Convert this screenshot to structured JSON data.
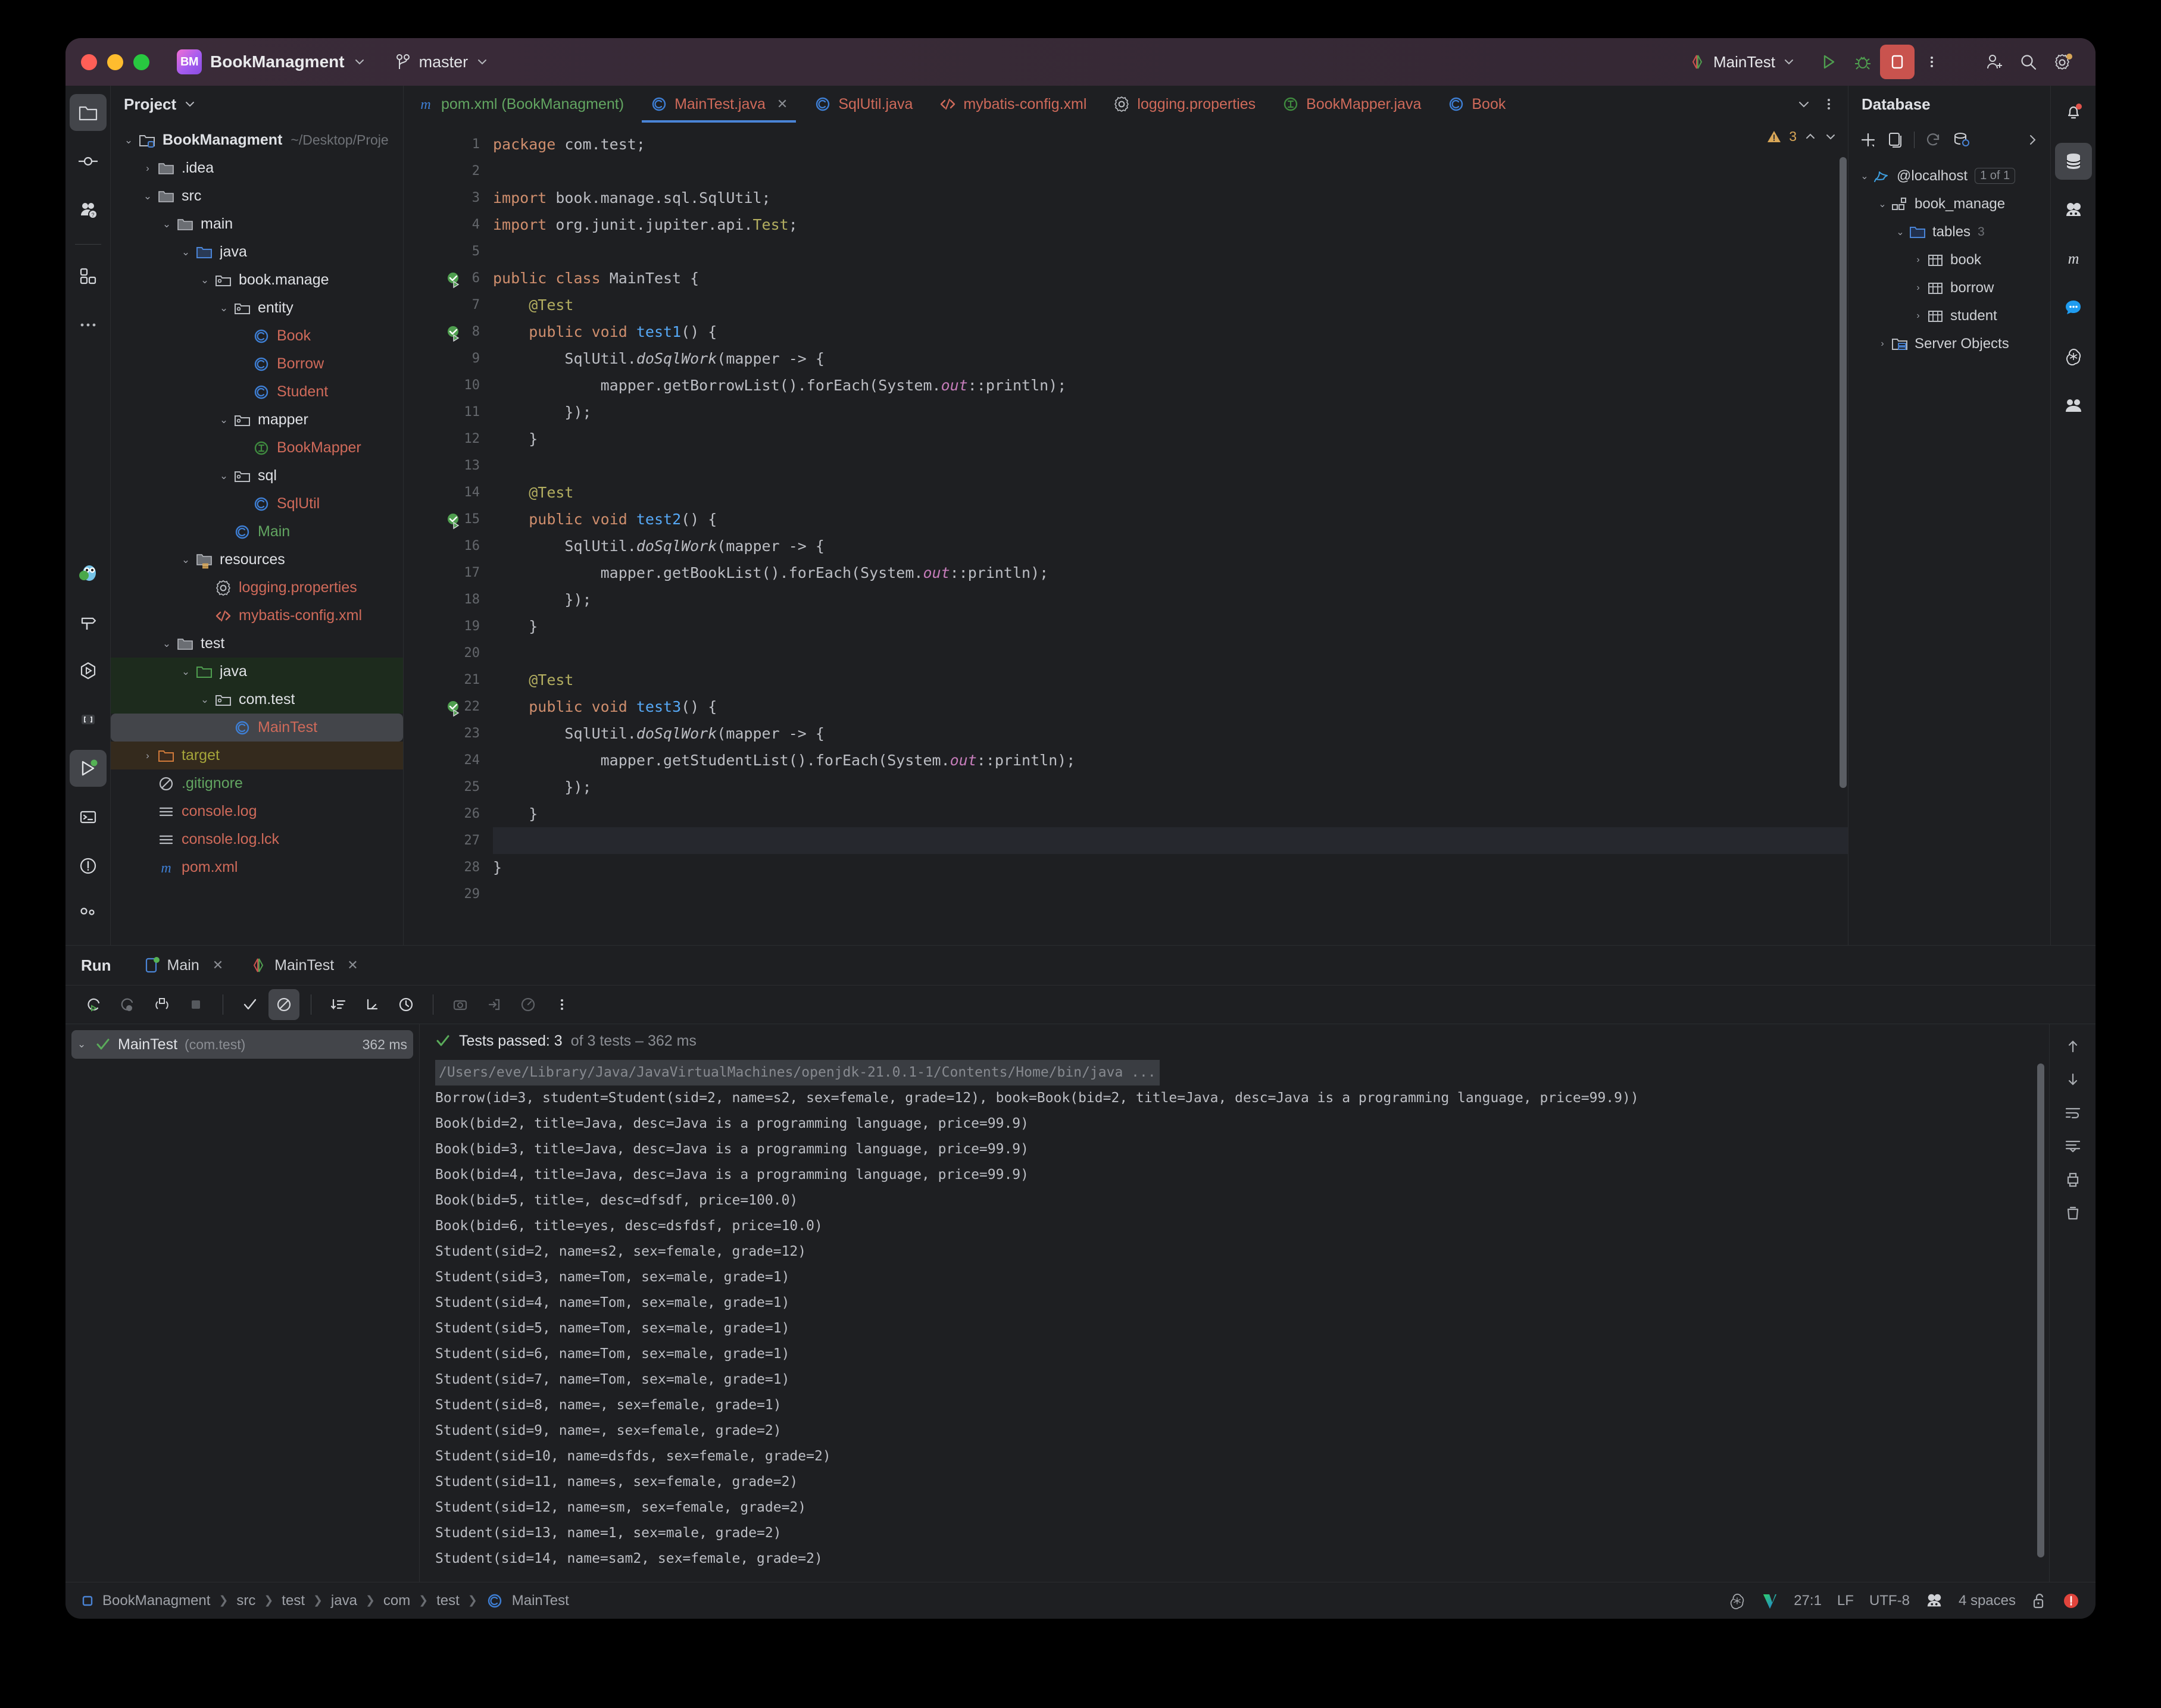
{
  "window": {
    "project_badge": "BM",
    "project_name": "BookManagment",
    "branch": "master"
  },
  "toolbar": {
    "run_config": "MainTest",
    "run_icon": "run-icon",
    "debug_icon": "debug-icon",
    "stop_icon": "stop-icon",
    "more_icon": "more-vertical-icon",
    "add_user_icon": "add-user-icon",
    "search_icon": "search-icon",
    "settings_icon": "settings-gear-icon"
  },
  "left_rail": {
    "top_items": [
      "project-icon",
      "commit-icon",
      "ai-assistant-icon",
      "structure-icon",
      "more-icon"
    ],
    "bottom_items": [
      "owl-icon",
      "build-hammer-icon",
      "services-icon",
      "bookmarks-icon",
      "run-icon",
      "terminal-icon",
      "problems-icon",
      "version-control-icon"
    ]
  },
  "project_panel": {
    "title": "Project",
    "tree": [
      {
        "depth": 0,
        "arrow": "down",
        "icon": "module-folder-icon",
        "label": "BookManagment",
        "sub": "~/Desktop/Proje",
        "cls": "c-white bold"
      },
      {
        "depth": 1,
        "arrow": "right",
        "icon": "folder-icon",
        "label": ".idea",
        "cls": "c-white"
      },
      {
        "depth": 1,
        "arrow": "down",
        "icon": "folder-icon",
        "label": "src",
        "cls": "c-white"
      },
      {
        "depth": 2,
        "arrow": "down",
        "icon": "folder-icon",
        "label": "main",
        "cls": "c-white"
      },
      {
        "depth": 3,
        "arrow": "down",
        "icon": "source-folder-icon",
        "label": "java",
        "cls": "c-white"
      },
      {
        "depth": 4,
        "arrow": "down",
        "icon": "package-icon",
        "label": "book.manage",
        "cls": "c-white"
      },
      {
        "depth": 5,
        "arrow": "down",
        "icon": "package-icon",
        "label": "entity",
        "cls": "c-white"
      },
      {
        "depth": 6,
        "arrow": "",
        "icon": "java-class-icon",
        "label": "Book",
        "cls": "c-red"
      },
      {
        "depth": 6,
        "arrow": "",
        "icon": "java-class-icon",
        "label": "Borrow",
        "cls": "c-red"
      },
      {
        "depth": 6,
        "arrow": "",
        "icon": "java-class-icon",
        "label": "Student",
        "cls": "c-red"
      },
      {
        "depth": 5,
        "arrow": "down",
        "icon": "package-icon",
        "label": "mapper",
        "cls": "c-white"
      },
      {
        "depth": 6,
        "arrow": "",
        "icon": "java-interface-icon",
        "label": "BookMapper",
        "cls": "c-red"
      },
      {
        "depth": 5,
        "arrow": "down",
        "icon": "package-icon",
        "label": "sql",
        "cls": "c-white"
      },
      {
        "depth": 6,
        "arrow": "",
        "icon": "java-class-icon",
        "label": "SqlUtil",
        "cls": "c-red"
      },
      {
        "depth": 5,
        "arrow": "",
        "icon": "java-class-icon",
        "label": "Main",
        "cls": "c-green"
      },
      {
        "depth": 3,
        "arrow": "down",
        "icon": "resource-folder-icon",
        "label": "resources",
        "cls": "c-white"
      },
      {
        "depth": 4,
        "arrow": "",
        "icon": "properties-icon",
        "label": "logging.properties",
        "cls": "c-red"
      },
      {
        "depth": 4,
        "arrow": "",
        "icon": "xml-icon",
        "label": "mybatis-config.xml",
        "cls": "c-red"
      },
      {
        "depth": 2,
        "arrow": "down",
        "icon": "folder-icon",
        "label": "test",
        "cls": "c-white"
      },
      {
        "depth": 3,
        "arrow": "down",
        "icon": "test-source-folder-icon",
        "label": "java",
        "cls": "c-white",
        "bg": "green-bg"
      },
      {
        "depth": 4,
        "arrow": "down",
        "icon": "package-icon",
        "label": "com.test",
        "cls": "c-white",
        "bg": "green-bg"
      },
      {
        "depth": 5,
        "arrow": "",
        "icon": "java-class-icon",
        "label": "MainTest",
        "cls": "c-red",
        "bg": "sel"
      },
      {
        "depth": 1,
        "arrow": "right",
        "icon": "excluded-folder-icon",
        "label": "target",
        "cls": "c-olive",
        "bg": "brown-bg"
      },
      {
        "depth": 1,
        "arrow": "",
        "icon": "gitignore-icon",
        "label": ".gitignore",
        "cls": "c-green"
      },
      {
        "depth": 1,
        "arrow": "",
        "icon": "text-file-icon",
        "label": "console.log",
        "cls": "c-red"
      },
      {
        "depth": 1,
        "arrow": "",
        "icon": "text-file-icon",
        "label": "console.log.lck",
        "cls": "c-red"
      },
      {
        "depth": 1,
        "arrow": "",
        "icon": "maven-icon",
        "label": "pom.xml",
        "cls": "c-red"
      }
    ]
  },
  "editor": {
    "tabs": [
      {
        "label": "pom.xml (BookManagment)",
        "icon": "maven-icon",
        "color": "#62a561",
        "active": false,
        "closable": false
      },
      {
        "label": "MainTest.java",
        "icon": "java-class-icon",
        "color": "#cf6a5a",
        "active": true,
        "closable": true
      },
      {
        "label": "SqlUtil.java",
        "icon": "java-class-icon",
        "color": "#cf6a5a",
        "active": false,
        "closable": false
      },
      {
        "label": "mybatis-config.xml",
        "icon": "xml-icon",
        "color": "#cf6a5a",
        "active": false,
        "closable": false
      },
      {
        "label": "logging.properties",
        "icon": "properties-icon",
        "color": "#cf6a5a",
        "active": false,
        "closable": false
      },
      {
        "label": "BookMapper.java",
        "icon": "java-interface-icon",
        "color": "#cf6a5a",
        "active": false,
        "closable": false
      },
      {
        "label": "Book",
        "icon": "java-class-icon",
        "color": "#cf6a5a",
        "active": false,
        "closable": false
      }
    ],
    "tab_overflow_icon": "chevron-down-icon",
    "tab_more_icon": "more-vertical-icon",
    "warning_count": "3",
    "warning_icon": "warning-triangle-icon",
    "lines": [
      {
        "n": 1,
        "mark": "",
        "text": "package com.test;"
      },
      {
        "n": 2,
        "mark": "",
        "text": ""
      },
      {
        "n": 3,
        "mark": "",
        "text": "import book.manage.sql.SqlUtil;"
      },
      {
        "n": 4,
        "mark": "",
        "text": "import org.junit.jupiter.api.Test;"
      },
      {
        "n": 5,
        "mark": "",
        "text": ""
      },
      {
        "n": 6,
        "mark": "test-passed-run-icon",
        "text": "public class MainTest {"
      },
      {
        "n": 7,
        "mark": "",
        "text": "    @Test"
      },
      {
        "n": 8,
        "mark": "test-passed-run-icon",
        "text": "    public void test1() {"
      },
      {
        "n": 9,
        "mark": "",
        "text": "        SqlUtil.doSqlWork(mapper -> {"
      },
      {
        "n": 10,
        "mark": "",
        "text": "            mapper.getBorrowList().forEach(System.out::println);"
      },
      {
        "n": 11,
        "mark": "",
        "text": "        });"
      },
      {
        "n": 12,
        "mark": "",
        "text": "    }"
      },
      {
        "n": 13,
        "mark": "",
        "text": ""
      },
      {
        "n": 14,
        "mark": "",
        "text": "    @Test"
      },
      {
        "n": 15,
        "mark": "test-passed-run-icon",
        "text": "    public void test2() {"
      },
      {
        "n": 16,
        "mark": "",
        "text": "        SqlUtil.doSqlWork(mapper -> {"
      },
      {
        "n": 17,
        "mark": "",
        "text": "            mapper.getBookList().forEach(System.out::println);"
      },
      {
        "n": 18,
        "mark": "",
        "text": "        });"
      },
      {
        "n": 19,
        "mark": "",
        "text": "    }"
      },
      {
        "n": 20,
        "mark": "",
        "text": ""
      },
      {
        "n": 21,
        "mark": "",
        "text": "    @Test"
      },
      {
        "n": 22,
        "mark": "test-passed-run-icon",
        "text": "    public void test3() {"
      },
      {
        "n": 23,
        "mark": "",
        "text": "        SqlUtil.doSqlWork(mapper -> {"
      },
      {
        "n": 24,
        "mark": "",
        "text": "            mapper.getStudentList().forEach(System.out::println);"
      },
      {
        "n": 25,
        "mark": "",
        "text": "        });"
      },
      {
        "n": 26,
        "mark": "",
        "text": "    }"
      },
      {
        "n": 27,
        "mark": "",
        "text": ""
      },
      {
        "n": 28,
        "mark": "",
        "text": "}"
      },
      {
        "n": 29,
        "mark": "",
        "text": ""
      }
    ]
  },
  "database_panel": {
    "title": "Database",
    "toolbar_icons": [
      "add-icon",
      "duplicate-icon",
      "refresh-icon",
      "db-settings-icon",
      "expand-arrow-icon"
    ],
    "tree": [
      {
        "depth": 0,
        "arrow": "down",
        "icon": "mysql-dolphin-icon",
        "label": "@localhost",
        "badge": "1 of 1"
      },
      {
        "depth": 1,
        "arrow": "down",
        "icon": "schema-icon",
        "label": "book_manage"
      },
      {
        "depth": 2,
        "arrow": "down",
        "icon": "tables-folder-icon",
        "label": "tables",
        "count": "3"
      },
      {
        "depth": 3,
        "arrow": "right",
        "icon": "table-icon",
        "label": "book"
      },
      {
        "depth": 3,
        "arrow": "right",
        "icon": "table-icon",
        "label": "borrow"
      },
      {
        "depth": 3,
        "arrow": "right",
        "icon": "table-icon",
        "label": "student"
      },
      {
        "depth": 1,
        "arrow": "right",
        "icon": "server-objects-icon",
        "label": "Server Objects"
      }
    ]
  },
  "right_rail": {
    "items": [
      "notifications-bell-icon",
      "database-icon",
      "ai-assistant-icon",
      "maven-icon",
      "chat-icon",
      "openai-icon",
      "plugins-icon"
    ]
  },
  "run_panel": {
    "label": "Run",
    "tabs": [
      {
        "label": "Main",
        "icon": "run-config-icon"
      },
      {
        "label": "MainTest",
        "icon": "test-config-icon"
      }
    ],
    "toolbar_icons": [
      "rerun-icon",
      "rerun-failed-icon",
      "rerun-auto-icon",
      "stop-icon",
      "show-passed-icon",
      "show-ignored-icon",
      "sort-icon",
      "expand-icon",
      "history-icon",
      "export-icon",
      "import-icon",
      "profile-icon",
      "more-vertical-icon"
    ],
    "tree": {
      "name": "MainTest",
      "package": "(com.test)",
      "duration": "362 ms",
      "status_icon": "check-icon"
    },
    "summary": {
      "passed_label": "Tests passed: 3",
      "detail": "of 3 tests – 362 ms",
      "icon": "check-icon"
    },
    "console_lines": [
      {
        "t": "/Users/eve/Library/Java/JavaVirtualMachines/openjdk-21.0.1-1/Contents/Home/bin/java ...",
        "cmd": true
      },
      {
        "t": "Borrow(id=3, student=Student(sid=2, name=s2, sex=female, grade=12), book=Book(bid=2, title=Java, desc=Java is a programming language, price=99.9))"
      },
      {
        "t": "Book(bid=2, title=Java, desc=Java is a programming language, price=99.9)"
      },
      {
        "t": "Book(bid=3, title=Java, desc=Java is a programming language, price=99.9)"
      },
      {
        "t": "Book(bid=4, title=Java, desc=Java is a programming language, price=99.9)"
      },
      {
        "t": "Book(bid=5, title=, desc=dfsdf, price=100.0)"
      },
      {
        "t": "Book(bid=6, title=yes, desc=dsfdsf, price=10.0)"
      },
      {
        "t": "Student(sid=2, name=s2, sex=female, grade=12)"
      },
      {
        "t": "Student(sid=3, name=Tom, sex=male, grade=1)"
      },
      {
        "t": "Student(sid=4, name=Tom, sex=male, grade=1)"
      },
      {
        "t": "Student(sid=5, name=Tom, sex=male, grade=1)"
      },
      {
        "t": "Student(sid=6, name=Tom, sex=male, grade=1)"
      },
      {
        "t": "Student(sid=7, name=Tom, sex=male, grade=1)"
      },
      {
        "t": "Student(sid=8, name=, sex=female, grade=1)"
      },
      {
        "t": "Student(sid=9, name=, sex=female, grade=2)"
      },
      {
        "t": "Student(sid=10, name=dsfds, sex=female, grade=2)"
      },
      {
        "t": "Student(sid=11, name=s, sex=female, grade=2)"
      },
      {
        "t": "Student(sid=12, name=sm, sex=female, grade=2)"
      },
      {
        "t": "Student(sid=13, name=1, sex=male, grade=2)"
      },
      {
        "t": "Student(sid=14, name=sam2, sex=female, grade=2)"
      }
    ],
    "console_rail_icons": [
      "scroll-up-icon",
      "scroll-down-icon",
      "soft-wrap-icon",
      "scroll-end-icon",
      "print-icon",
      "clear-icon"
    ]
  },
  "status_bar": {
    "breadcrumbs": [
      "BookManagment",
      "src",
      "test",
      "java",
      "com",
      "test",
      "MainTest"
    ],
    "breadcrumb_icon": "module-icon",
    "breadcrumb_last_icon": "java-class-icon",
    "right": {
      "openai_icon": "openai-icon",
      "vim_icon": "vim-icon",
      "caret": "27:1",
      "line_sep": "LF",
      "encoding": "UTF-8",
      "ai_icon": "ai-assistant-icon",
      "indent": "4 spaces",
      "lock_icon": "unlocked-icon",
      "error_icon": "error-badge-icon"
    }
  },
  "colors": {
    "accent_blue": "#4a84d6",
    "tab_red": "#cf6a5a",
    "green": "#62a561",
    "stop_red": "#c9534e",
    "panel_bg": "#1e1f22"
  }
}
